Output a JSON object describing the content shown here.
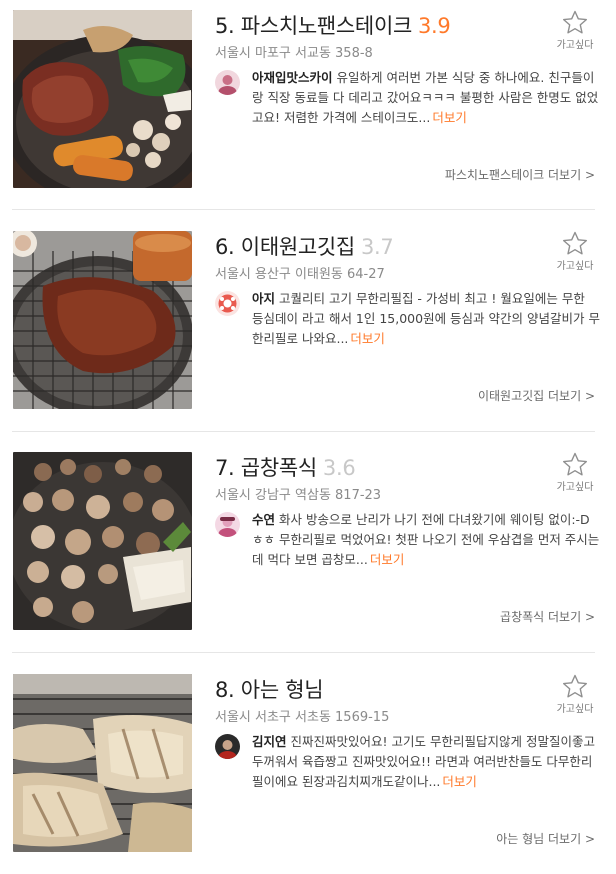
{
  "colors": {
    "score_high": "#ff792a",
    "score_low": "#c8c8c8",
    "more_link": "#ff792a"
  },
  "restaurants": [
    {
      "rank_name": "5. 파스치노팬스테이크",
      "score": "3.9",
      "score_tone": "high",
      "address": "서울시 마포구 서교동 358-8",
      "reviewer": "아재입맛스카이",
      "review": "유일하게 여러번 가본 식당 중 하나에요. 친구들이랑 직장 동료들 다 데리고 갔어요ㅋㅋㅋ 불평한 사람은 한명도 없었고요! 저렴한 가격에 스테이크도...",
      "more": "더보기",
      "fav_label": "가고싶다",
      "detail_link": "파스치노팬스테이크 더보기 >",
      "photo_icon": "steak-photo",
      "avatar_icon": "user-avatar-pink"
    },
    {
      "rank_name": "6. 이태원고깃집",
      "score": "3.7",
      "score_tone": "low",
      "address": "서울시 용산구 이태원동 64-27",
      "reviewer": "아지",
      "review": "고퀄리티 고기 무한리필집 - 가성비 최고 ! 월요일에는 무한 등심데이 라고 해서 1인 15,000원에 등심과 약간의 양념갈비가 무한리필로 나와요...",
      "more": "더보기",
      "fav_label": "가고싶다",
      "detail_link": "이태원고깃집 더보기 >",
      "photo_icon": "grilled-meat-photo",
      "avatar_icon": "user-avatar-red"
    },
    {
      "rank_name": "7. 곱창폭식",
      "score": "3.6",
      "score_tone": "low",
      "address": "서울시 강남구 역삼동 817-23",
      "reviewer": "수연",
      "review": "화사 방송으로 난리가 나기 전에 다녀왔기에 웨이팅 없이:-Dㅎㅎ 무한리필로 먹었어요! 첫판 나오기 전에 우삼겹을 먼저 주시는데 먹다 보면 곱창모...",
      "more": "더보기",
      "fav_label": "가고싶다",
      "detail_link": "곱창폭식 더보기 >",
      "photo_icon": "gopchang-photo",
      "avatar_icon": "user-avatar-rose"
    },
    {
      "rank_name": "8. 아는 형님",
      "score": "",
      "score_tone": "low",
      "address": "서울시 서초구 서초동 1569-15",
      "reviewer": "김지연",
      "review": "진짜진짜맛있어요! 고기도 무한리필답지않게 정말질이좋고 두꺼워서 육즙짱고 진짜맛있어요!! 라면과 여러반찬들도 다무한리필이에요 된장과김치찌개도같이나...",
      "more": "더보기",
      "fav_label": "가고싶다",
      "detail_link": "아는 형님 더보기 >",
      "photo_icon": "pork-belly-photo",
      "avatar_icon": "user-avatar-dark"
    }
  ]
}
